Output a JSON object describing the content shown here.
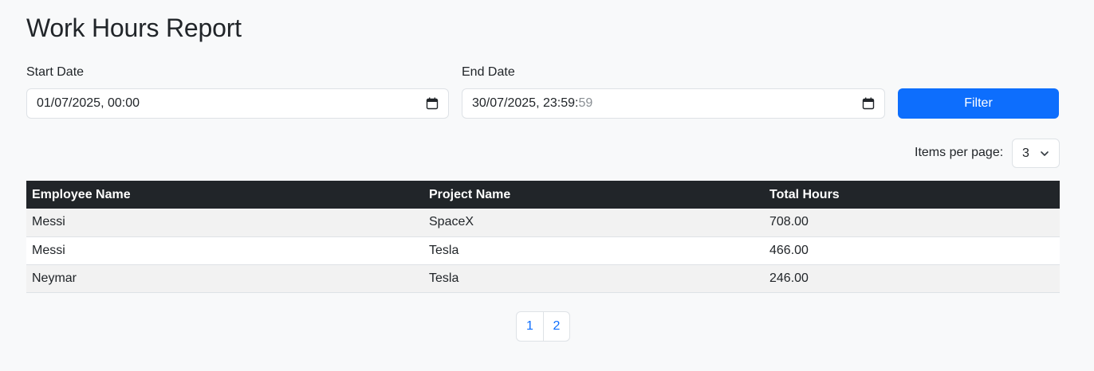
{
  "title": "Work Hours Report",
  "filters": {
    "start_label": "Start Date",
    "start_value": "01/07/2025, 00:00",
    "end_label": "End Date",
    "end_value_main": "30/07/2025, 23:59:",
    "end_value_seconds": "59",
    "filter_button": "Filter"
  },
  "per_page": {
    "label": "Items per page:",
    "value": "3"
  },
  "table": {
    "headers": [
      "Employee Name",
      "Project Name",
      "Total Hours"
    ],
    "rows": [
      [
        "Messi",
        "SpaceX",
        "708.00"
      ],
      [
        "Messi",
        "Tesla",
        "466.00"
      ],
      [
        "Neymar",
        "Tesla",
        "246.00"
      ]
    ]
  },
  "pagination": [
    "1",
    "2"
  ],
  "colors": {
    "primary": "#0d6efd",
    "table_header": "#212529"
  }
}
